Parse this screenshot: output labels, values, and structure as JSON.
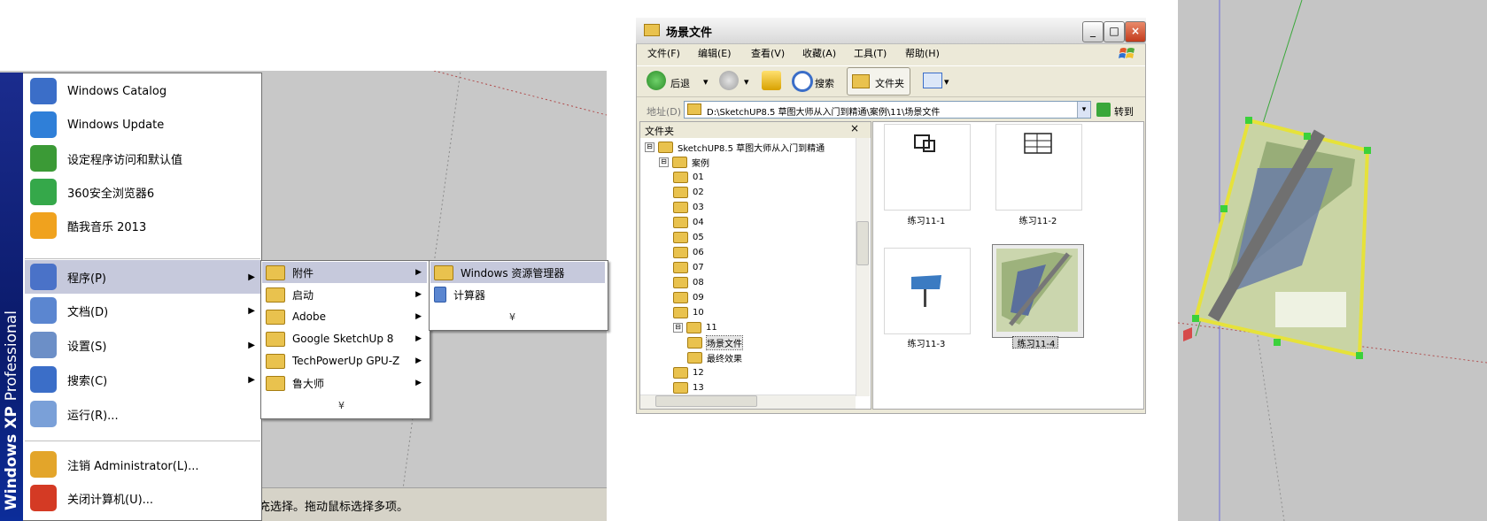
{
  "left": {
    "band_text": "Windows XP",
    "band_text_pro": "Professional",
    "status_text": "充选择。拖动鼠标选择多项。",
    "top_items": [
      {
        "label": "Windows Catalog",
        "icon": "windows-catalog-icon",
        "color": "#3b6ec8"
      },
      {
        "label": "Windows Update",
        "icon": "windows-update-icon",
        "color": "#2f7fd8"
      },
      {
        "label": "设定程序访问和默认值",
        "icon": "program-access-icon",
        "color": "#3b9a36"
      },
      {
        "label": "360安全浏览器6",
        "icon": "browser-360-icon",
        "color": "#35a84a"
      },
      {
        "label": "酷我音乐 2013",
        "icon": "kuwo-music-icon",
        "color": "#f0a21e"
      }
    ],
    "bottom_items": [
      {
        "label": "程序(P)",
        "icon": "programs-icon",
        "arrow": "▶"
      },
      {
        "label": "文档(D)",
        "icon": "documents-icon",
        "arrow": "▶"
      },
      {
        "label": "设置(S)",
        "icon": "settings-icon",
        "arrow": "▶"
      },
      {
        "label": "搜索(C)",
        "icon": "search-icon",
        "arrow": "▶"
      },
      {
        "label": "运行(R)...",
        "icon": "run-icon",
        "arrow": ""
      }
    ],
    "logoff": {
      "label": "注销 Administrator(L)...",
      "icon": "logoff-icon"
    },
    "shutdown": {
      "label": "关闭计算机(U)...",
      "icon": "shutdown-icon"
    },
    "programs_submenu": [
      {
        "label": "附件",
        "arrow": "▶"
      },
      {
        "label": "启动",
        "arrow": "▶"
      },
      {
        "label": "Adobe",
        "arrow": "▶"
      },
      {
        "label": "Google SketchUp 8",
        "arrow": "▶"
      },
      {
        "label": "TechPowerUp GPU-Z",
        "arrow": "▶"
      },
      {
        "label": "鲁大师",
        "arrow": "▶"
      }
    ],
    "accessories_submenu": [
      {
        "label": "Windows 资源管理器"
      },
      {
        "label": "计算器"
      }
    ],
    "expand_chevron": "¥"
  },
  "explorer": {
    "title": "场景文件",
    "window_buttons": {
      "minimize": "_",
      "maximize": "□",
      "close": "×"
    },
    "menu": [
      "文件(F)",
      "编辑(E)",
      "查看(V)",
      "收藏(A)",
      "工具(T)",
      "帮助(H)"
    ],
    "toolbar": {
      "back": "后退",
      "search": "搜索",
      "folders": "文件夹"
    },
    "address_label": "地址(D)",
    "address_value": "D:\\SketchUP8.5 草图大师从入门到精通\\案例\\11\\场景文件",
    "go_label": "转到",
    "folders_title": "文件夹",
    "folders_close": "×",
    "tree": [
      {
        "label": "SketchUP8.5 草图大师从入门到精通",
        "pm": "⊟",
        "indent": 0
      },
      {
        "label": "案例",
        "pm": "⊟",
        "indent": 1
      },
      {
        "label": "01",
        "pm": "",
        "indent": 2
      },
      {
        "label": "02",
        "pm": "",
        "indent": 2
      },
      {
        "label": "03",
        "pm": "",
        "indent": 2
      },
      {
        "label": "04",
        "pm": "",
        "indent": 2
      },
      {
        "label": "05",
        "pm": "",
        "indent": 2
      },
      {
        "label": "06",
        "pm": "",
        "indent": 2
      },
      {
        "label": "07",
        "pm": "",
        "indent": 2
      },
      {
        "label": "08",
        "pm": "",
        "indent": 2
      },
      {
        "label": "09",
        "pm": "",
        "indent": 2
      },
      {
        "label": "10",
        "pm": "",
        "indent": 2
      },
      {
        "label": "11",
        "pm": "⊟",
        "indent": 2
      },
      {
        "label": "场景文件",
        "pm": "",
        "indent": 3
      },
      {
        "label": "最终效果",
        "pm": "",
        "indent": 3
      },
      {
        "label": "12",
        "pm": "",
        "indent": 2
      },
      {
        "label": "13",
        "pm": "",
        "indent": 2
      }
    ],
    "files": [
      {
        "label": "练习11-1"
      },
      {
        "label": "练习11-2"
      },
      {
        "label": "练习11-3"
      },
      {
        "label": "练习11-4"
      }
    ]
  }
}
